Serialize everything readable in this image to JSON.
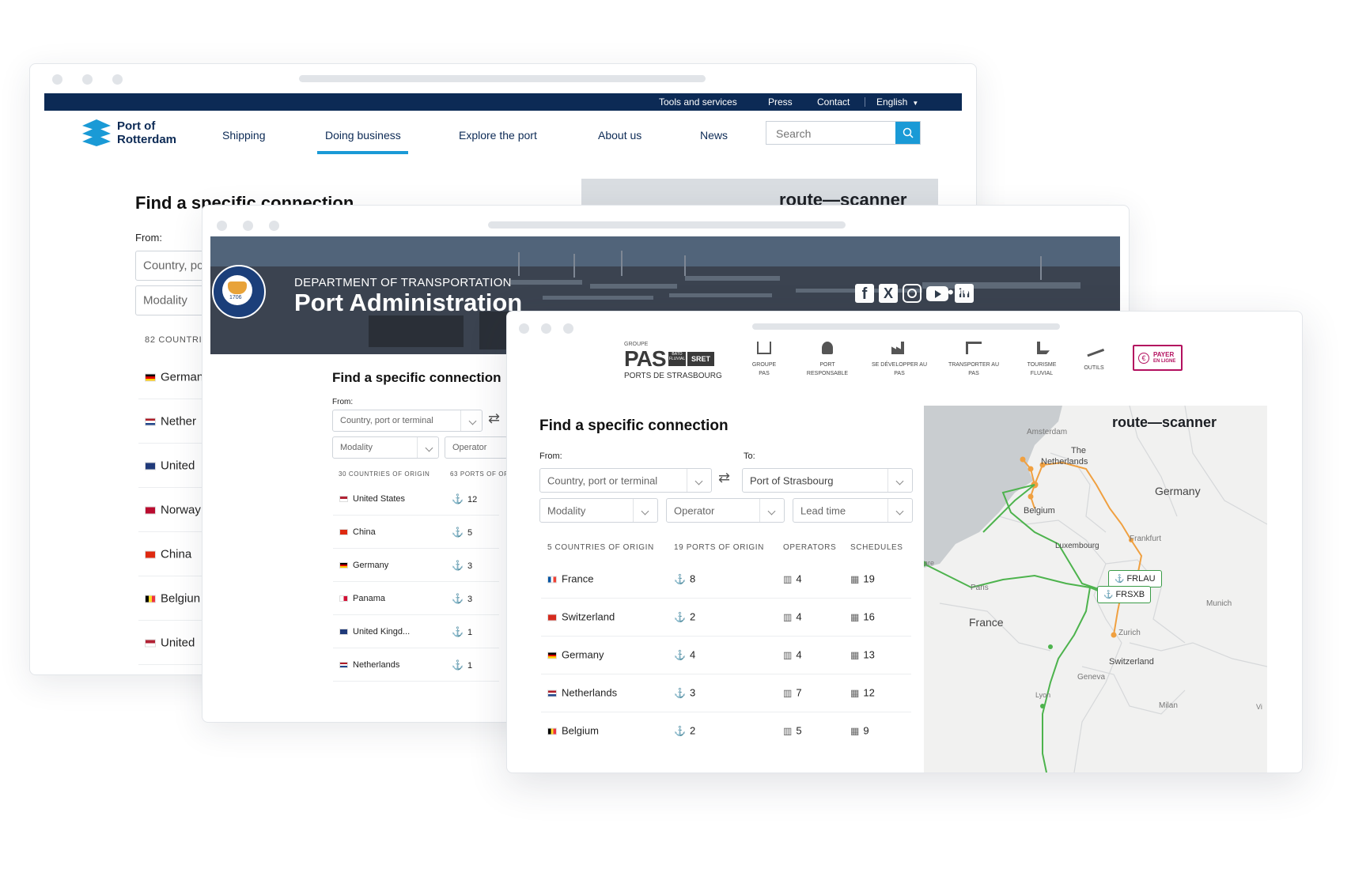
{
  "rotterdam": {
    "topbar": {
      "tools": "Tools and services",
      "press": "Press",
      "contact": "Contact",
      "lang": "English"
    },
    "logo": {
      "line1": "Port of",
      "line2": "Rotterdam"
    },
    "nav": [
      "Shipping",
      "Doing business",
      "Explore the port",
      "About us",
      "News"
    ],
    "search_placeholder": "Search",
    "title": "Find a specific connection",
    "from_label": "From:",
    "from_placeholder": "Country, pc",
    "modality_placeholder": "Modality",
    "count": "82 COUNTRI",
    "banner_logo": "route—scanner",
    "rows": [
      "German",
      "Nether",
      "United",
      "Norway",
      "China",
      "Belgiun",
      "United"
    ]
  },
  "baltimore": {
    "dept": "DEPARTMENT OF TRANSPORTATION",
    "title": "Port Administration",
    "seal_year": "1706",
    "title2": "Find a specific connection",
    "from_label": "From:",
    "from_placeholder": "Country, port or terminal",
    "modality": "Modality",
    "operator": "Operator",
    "col1": "30 COUNTRIES OF ORIGIN",
    "col2": "63 PORTS OF OR",
    "rows": [
      {
        "name": "United States",
        "ports": "12"
      },
      {
        "name": "China",
        "ports": "5"
      },
      {
        "name": "Germany",
        "ports": "3"
      },
      {
        "name": "Panama",
        "ports": "3"
      },
      {
        "name": "United Kingd...",
        "ports": "1"
      },
      {
        "name": "Netherlands",
        "ports": "1"
      }
    ]
  },
  "strasbourg": {
    "logo_groupe": "GROUPE",
    "logo_main": "PAS",
    "logo_bat": "BATO FLUVIAL",
    "logo_sret": "SRET",
    "logo_sub": "PORTS DE STRASBOURG",
    "nav": [
      {
        "l1": "GROUPE",
        "l2": "PAS"
      },
      {
        "l1": "PORT",
        "l2": "RESPONSABLE"
      },
      {
        "l1": "SE DÉVELOPPER AU",
        "l2": "PAS"
      },
      {
        "l1": "TRANSPORTER AU",
        "l2": "PAS"
      },
      {
        "l1": "TOURISME",
        "l2": "FLUVIAL"
      },
      {
        "l1": "OUTILS",
        "l2": ""
      }
    ],
    "payer_l1": "PAYER",
    "payer_l2": "EN LIGNE",
    "title": "Find a specific connection",
    "from_label": "From:",
    "to_label": "To:",
    "from_placeholder": "Country, port or terminal",
    "to_value": "Port of Strasbourg",
    "modality": "Modality",
    "operator": "Operator",
    "leadtime": "Lead time",
    "cols": [
      "5 COUNTRIES OF ORIGIN",
      "19 PORTS OF ORIGIN",
      "OPERATORS",
      "SCHEDULES"
    ],
    "rows": [
      {
        "name": "France",
        "ports": "8",
        "ops": "4",
        "sched": "19"
      },
      {
        "name": "Switzerland",
        "ports": "2",
        "ops": "4",
        "sched": "16"
      },
      {
        "name": "Germany",
        "ports": "4",
        "ops": "4",
        "sched": "13"
      },
      {
        "name": "Netherlands",
        "ports": "3",
        "ops": "7",
        "sched": "12"
      },
      {
        "name": "Belgium",
        "ports": "2",
        "ops": "5",
        "sched": "9"
      }
    ],
    "map": {
      "logo": "route—scanner",
      "labels": {
        "amsterdam": "Amsterdam",
        "the": "The",
        "netherlands": "Netherlands",
        "belgium": "Belgium",
        "germany": "Germany",
        "luxembourg": "Luxembourg",
        "frankfurt": "Frankfurt",
        "paris": "Paris",
        "france": "France",
        "munich": "Munich",
        "zurich": "Zurich",
        "switzerland": "Switzerland",
        "geneva": "Geneva",
        "lyon": "Lyon",
        "milan": "Milan",
        "are": "are",
        "vi": "Vi"
      },
      "tag1": "FRLAU",
      "tag2": "FRSXB"
    }
  }
}
